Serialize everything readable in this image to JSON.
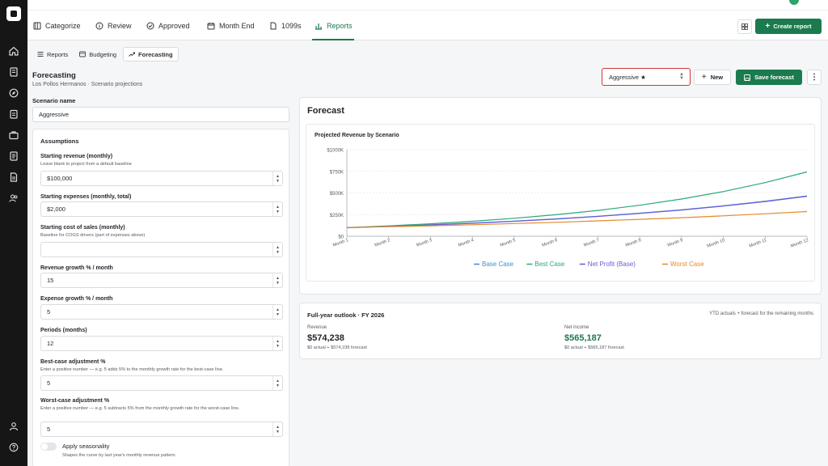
{
  "nav": {
    "tabs": [
      {
        "label": "Categorize",
        "icon": "categorize-icon"
      },
      {
        "label": "Review",
        "icon": "info-icon"
      },
      {
        "label": "Approved",
        "icon": "check-circle-icon"
      },
      {
        "label": "Month End",
        "icon": "calendar-icon"
      },
      {
        "label": "1099s",
        "icon": "document-icon"
      },
      {
        "label": "Reports",
        "icon": "bar-chart-icon"
      }
    ],
    "active_tab": "Reports",
    "create_report_label": "Create report"
  },
  "subtabs": [
    {
      "label": "Reports",
      "icon": "list-icon"
    },
    {
      "label": "Budgeting",
      "icon": "budget-icon"
    },
    {
      "label": "Forecasting",
      "icon": "trend-icon"
    }
  ],
  "active_subtab": "Forecasting",
  "page": {
    "title": "Forecasting",
    "subtitle": "Los Pollos Hermanos · Scenario projections"
  },
  "controls": {
    "scenario_selected": "Aggressive ★",
    "new_label": "New",
    "save_label": "Save forecast"
  },
  "scenario": {
    "label": "Scenario name",
    "value": "Aggressive"
  },
  "assumptions": {
    "title": "Assumptions",
    "fields": [
      {
        "label": "Starting revenue (monthly)",
        "help": "Leave blank to project from a default baseline",
        "value": "$100,000"
      },
      {
        "label": "Starting expenses (monthly, total)",
        "help": "",
        "value": "$2,000"
      },
      {
        "label": "Starting cost of sales (monthly)",
        "help": "Baseline for COGS drivers (part of expenses above)",
        "value": ""
      },
      {
        "label": "Revenue growth % / month",
        "help": "",
        "value": "15"
      },
      {
        "label": "Expense growth % / month",
        "help": "",
        "value": "5"
      },
      {
        "label": "Periods (months)",
        "help": "",
        "value": "12"
      },
      {
        "label": "Best-case adjustment %",
        "help": "Enter a positive number — e.g. 5 adds 5% to the monthly growth rate for the best-case line.",
        "value": "5"
      },
      {
        "label": "Worst-case adjustment %",
        "help": "Enter a positive number — e.g. 5 subtracts 5% from the monthly growth rate for the worst-case line.",
        "value": "5"
      }
    ],
    "seasonality_label": "Apply seasonality",
    "seasonality_help": "Shapes the curve by last year's monthly revenue pattern.",
    "seasonality_on": false
  },
  "forecast": {
    "title": "Forecast"
  },
  "chart_data": {
    "type": "line",
    "title": "Projected Revenue by Scenario",
    "categories": [
      "Month 1",
      "Month 2",
      "Month 3",
      "Month 4",
      "Month 5",
      "Month 6",
      "Month 7",
      "Month 8",
      "Month 9",
      "Month 10",
      "Month 11",
      "Month 12"
    ],
    "y_ticks": [
      "$0",
      "$250K",
      "$500K",
      "$750K",
      "$1000K"
    ],
    "ylim": [
      0,
      1000000
    ],
    "series": [
      {
        "name": "Base Case",
        "color": "#3b8fd4",
        "values": [
          100000,
          115000,
          132250,
          152088,
          174901,
          201136,
          231306,
          266002,
          305902,
          351788,
          404556,
          465239
        ]
      },
      {
        "name": "Best Case",
        "color": "#2aa876",
        "values": [
          100000,
          120000,
          144000,
          172800,
          207360,
          248832,
          298598,
          358318,
          429982,
          515978,
          619174,
          743008
        ]
      },
      {
        "name": "Net Profit (Base)",
        "color": "#6b5bd6",
        "values": [
          98000,
          112900,
          130045,
          149773,
          172470,
          198583,
          228626,
          263188,
          302943,
          348681,
          401290,
          461781
        ]
      },
      {
        "name": "Worst Case",
        "color": "#e6892a",
        "values": [
          100000,
          110000,
          121000,
          133100,
          146410,
          161051,
          177156,
          194872,
          214359,
          235795,
          259374,
          285312
        ]
      }
    ],
    "legend_position": "bottom",
    "grid": true
  },
  "outlook": {
    "title": "Full-year outlook · FY 2026",
    "note": "YTD actuals + forecast for the remaining months",
    "revenue_label": "Revenue",
    "revenue_value": "$574,238",
    "revenue_sub": "$0 actual + $574,238 forecast",
    "net_label": "Net income",
    "net_value": "$565,187",
    "net_sub": "$0 actual + $565,187 forecast"
  }
}
